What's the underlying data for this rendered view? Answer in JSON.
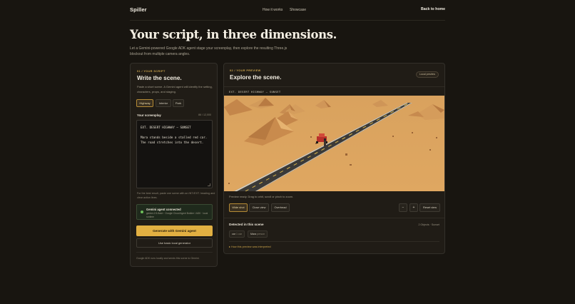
{
  "header": {
    "brand": "Spiller",
    "nav": [
      "How it works",
      "Showcase"
    ],
    "back_label": "Back to home"
  },
  "hero": {
    "title": "Your script, in three dimensions.",
    "subtitle": "Let a Gemini-powered Google ADK agent stage your screenplay, then explore the resulting Three.js blockout from multiple camera angles."
  },
  "write_panel": {
    "eyebrow": "01 / YOUR SCRIPT",
    "title": "Write the scene.",
    "description": "Paste a short scene. A Gemini agent will identify the setting, characters, props, and staging.",
    "presets": [
      {
        "label": "Highway",
        "active": true
      },
      {
        "label": "Interior",
        "active": false
      },
      {
        "label": "Park",
        "active": false
      }
    ],
    "screenplay_label": "Your screenplay",
    "char_count": "86 / 12,000",
    "screenplay_lines": [
      "EXT. DESERT HIGHWAY — SUNSET",
      "",
      "Mara stands beside a stalled red car.",
      "The road stretches into the desert."
    ],
    "tip": "For the best result, paste one scene with an INT./EXT. heading and clear action lines.",
    "agent": {
      "title": "Gemini agent connected",
      "detail": "gemini-2.5-flash · Google Cloud Agent Builder / ADK · local runtime",
      "status_color": "#6dbf5a"
    },
    "generate_label": "Generate with Gemini agent",
    "basic_label": "Use basic local generator",
    "footnote": "Google ADK runs locally and sends this scene to Gemini."
  },
  "preview_panel": {
    "eyebrow": "02 / YOUR PREVIEW",
    "title": "Explore the scene.",
    "badge": "Local preview",
    "scene_heading": "EXT. DESERT HIGHWAY — SUNSET",
    "status": "Preview ready. Drag to orbit, scroll or pinch to zoom.",
    "views": [
      {
        "label": "Wide shot",
        "active": true
      },
      {
        "label": "Close view",
        "active": false
      },
      {
        "label": "Overhead",
        "active": false
      }
    ],
    "zoom_out": "−",
    "zoom_in": "+",
    "reset_label": "Reset view",
    "detected_title": "Detected in this scene",
    "detected_count": "2 Objects · Sunset",
    "tags": [
      {
        "label": "car",
        "sub": "1 car"
      },
      {
        "label": "Mara",
        "sub": "person"
      }
    ],
    "interpretation_label": "▸  How this preview was interpreted"
  },
  "colors": {
    "accent": "#e2b042",
    "background": "#181510",
    "card": "#201c16",
    "desert": "#d9a25e",
    "road": "#3b3a38"
  }
}
